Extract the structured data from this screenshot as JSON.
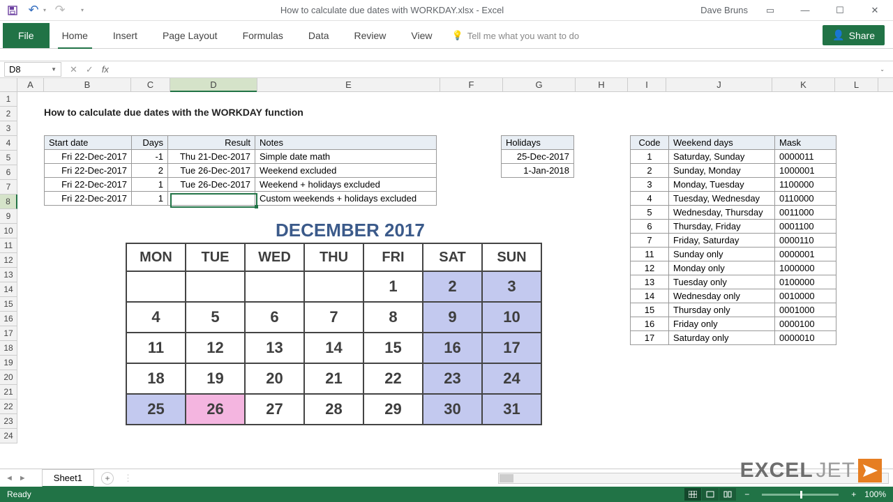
{
  "app": {
    "title": "How to calculate due dates with WORKDAY.xlsx - Excel",
    "user": "Dave Bruns"
  },
  "qat": {
    "save": "💾",
    "undo": "↶",
    "redo": "↷"
  },
  "tabs": {
    "file": "File",
    "items": [
      "Home",
      "Insert",
      "Page Layout",
      "Formulas",
      "Data",
      "Review",
      "View"
    ],
    "tellme": "Tell me what you want to do",
    "share": "Share"
  },
  "formula": {
    "namebox": "D8",
    "fx": "fx",
    "value": ""
  },
  "columns": [
    "A",
    "B",
    "C",
    "D",
    "E",
    "F",
    "G",
    "H",
    "I",
    "J",
    "K",
    "L"
  ],
  "rows": 24,
  "activeRow": 8,
  "activeCol": "D",
  "sheet": {
    "title": "How to calculate due dates with the WORKDAY function",
    "mainHeaders": [
      "Start date",
      "Days",
      "Result",
      "Notes"
    ],
    "mainRows": [
      [
        "Fri 22-Dec-2017",
        "-1",
        "Thu 21-Dec-2017",
        "Simple date math"
      ],
      [
        "Fri 22-Dec-2017",
        "2",
        "Tue 26-Dec-2017",
        "Weekend excluded"
      ],
      [
        "Fri 22-Dec-2017",
        "1",
        "Tue 26-Dec-2017",
        "Weekend + holidays excluded"
      ],
      [
        "Fri 22-Dec-2017",
        "1",
        "",
        "Custom weekends + holidays excluded"
      ]
    ],
    "holHeader": "Holidays",
    "holidays": [
      "25-Dec-2017",
      "1-Jan-2018"
    ],
    "codeHeaders": [
      "Code",
      "Weekend days",
      "Mask"
    ],
    "codes": [
      [
        "1",
        "Saturday, Sunday",
        "0000011"
      ],
      [
        "2",
        "Sunday, Monday",
        "1000001"
      ],
      [
        "3",
        "Monday, Tuesday",
        "1100000"
      ],
      [
        "4",
        "Tuesday, Wednesday",
        "0110000"
      ],
      [
        "5",
        "Wednesday, Thursday",
        "0011000"
      ],
      [
        "6",
        "Thursday, Friday",
        "0001100"
      ],
      [
        "7",
        "Friday, Saturday",
        "0000110"
      ],
      [
        "11",
        "Sunday only",
        "0000001"
      ],
      [
        "12",
        "Monday only",
        "1000000"
      ],
      [
        "13",
        "Tuesday only",
        "0100000"
      ],
      [
        "14",
        "Wednesday only",
        "0010000"
      ],
      [
        "15",
        "Thursday only",
        "0001000"
      ],
      [
        "16",
        "Friday only",
        "0000100"
      ],
      [
        "17",
        "Saturday only",
        "0000010"
      ]
    ],
    "calTitle": "DECEMBER 2017",
    "calDays": [
      "MON",
      "TUE",
      "WED",
      "THU",
      "FRI",
      "SAT",
      "SUN"
    ],
    "calGrid": [
      [
        "",
        "",
        "",
        "",
        "1",
        "2",
        "3"
      ],
      [
        "4",
        "5",
        "6",
        "7",
        "8",
        "9",
        "10"
      ],
      [
        "11",
        "12",
        "13",
        "14",
        "15",
        "16",
        "17"
      ],
      [
        "18",
        "19",
        "20",
        "21",
        "22",
        "23",
        "24"
      ],
      [
        "25",
        "26",
        "27",
        "28",
        "29",
        "30",
        "31"
      ]
    ]
  },
  "tabs_bottom": {
    "sheet": "Sheet1"
  },
  "status": {
    "ready": "Ready",
    "zoom": "100%"
  },
  "watermark": {
    "a": "EXCEL",
    "b": "JET"
  }
}
